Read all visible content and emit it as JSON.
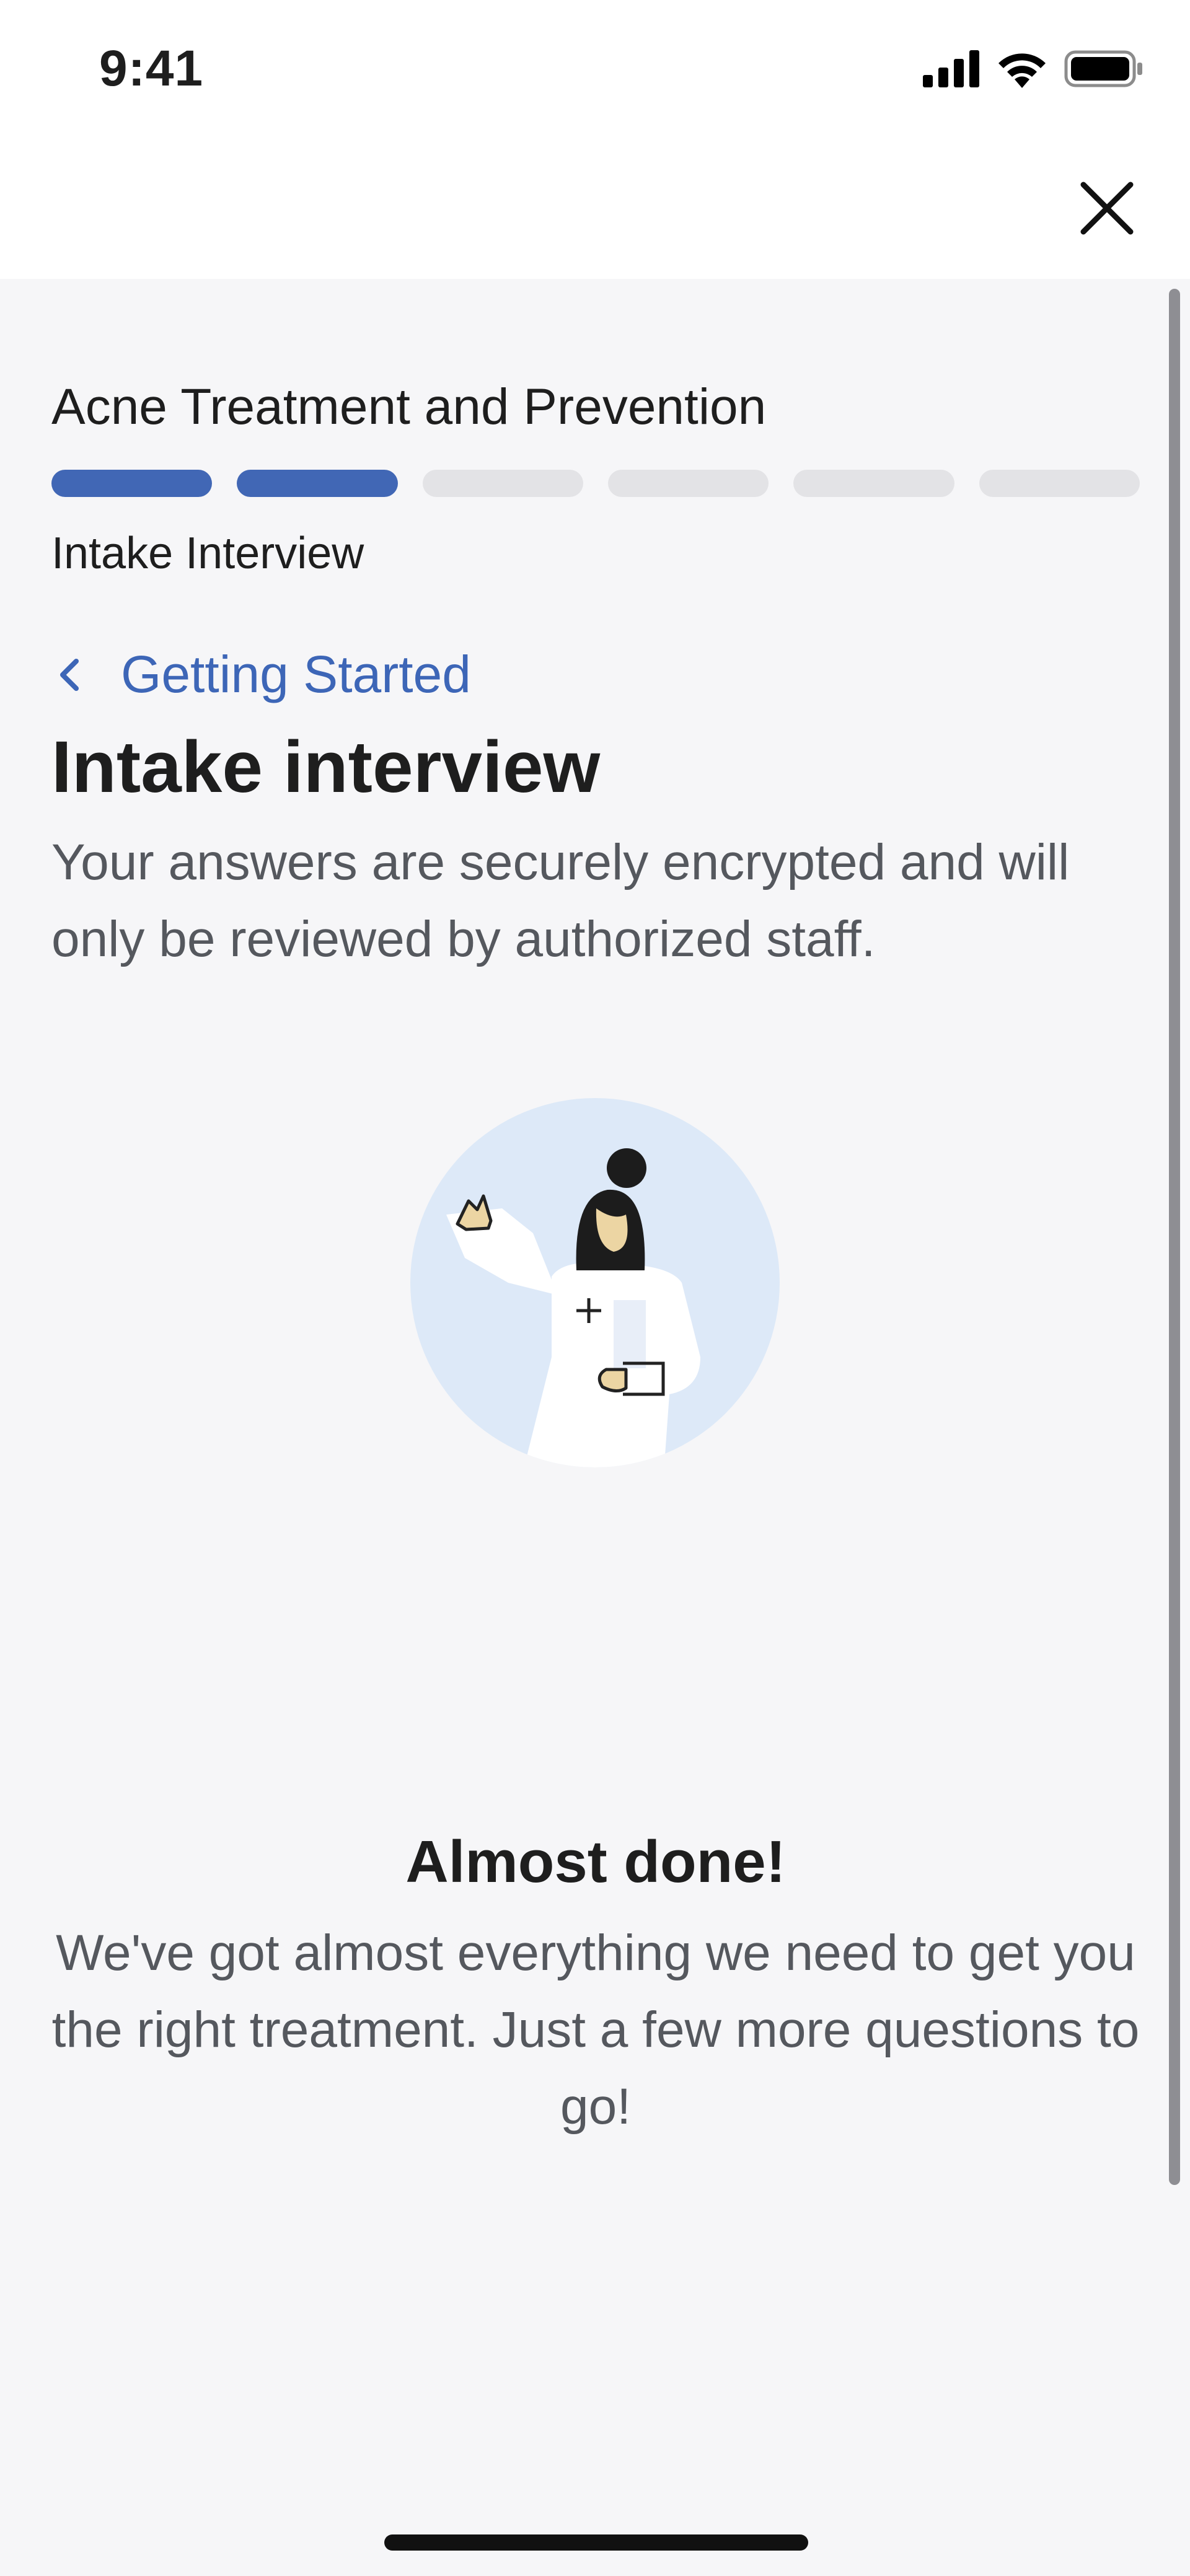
{
  "status_bar": {
    "time": "9:41"
  },
  "header": {
    "close_icon": "close-icon"
  },
  "course": {
    "title": "Acne Treatment and Prevention",
    "progress": {
      "total_steps": 6,
      "completed_steps": 2
    },
    "section": "Intake Interview"
  },
  "nav": {
    "back_label": "Getting Started",
    "back_icon": "chevron-left-icon"
  },
  "page": {
    "heading": "Intake interview",
    "description": "Your answers are securely encrypted and will only be reviewed by authorized staff."
  },
  "illustration": {
    "icon": "doctor-waving-illustration"
  },
  "completion": {
    "title": "Almost done!",
    "message": "We've got almost everything we need to get you the right treatment. Just a few more questions to go!"
  },
  "colors": {
    "accent": "#4167b5",
    "link": "#3d66b7",
    "background": "#f6f6f8",
    "progress_empty": "#e3e3e6",
    "illustration_circle": "#dde9f8"
  }
}
